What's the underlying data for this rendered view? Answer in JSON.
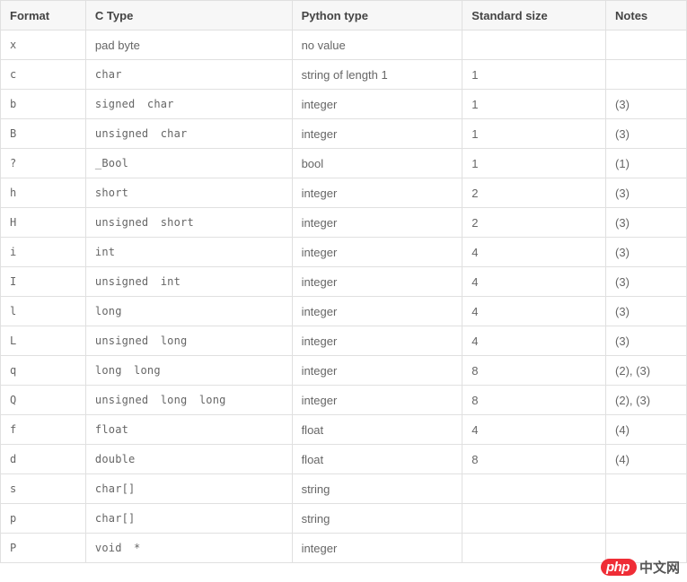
{
  "table": {
    "headers": [
      "Format",
      "C Type",
      "Python type",
      "Standard size",
      "Notes"
    ],
    "rows": [
      {
        "format": "x",
        "ctype": "pad byte",
        "ctype_mono": false,
        "python": "no value",
        "size": "",
        "notes": ""
      },
      {
        "format": "c",
        "ctype": "char",
        "ctype_mono": true,
        "python": "string of length 1",
        "size": "1",
        "notes": ""
      },
      {
        "format": "b",
        "ctype": "signed char",
        "ctype_mono": true,
        "python": "integer",
        "size": "1",
        "notes": "(3)"
      },
      {
        "format": "B",
        "ctype": "unsigned char",
        "ctype_mono": true,
        "python": "integer",
        "size": "1",
        "notes": "(3)"
      },
      {
        "format": "?",
        "ctype": "_Bool",
        "ctype_mono": true,
        "python": "bool",
        "size": "1",
        "notes": "(1)"
      },
      {
        "format": "h",
        "ctype": "short",
        "ctype_mono": true,
        "python": "integer",
        "size": "2",
        "notes": "(3)"
      },
      {
        "format": "H",
        "ctype": "unsigned short",
        "ctype_mono": true,
        "python": "integer",
        "size": "2",
        "notes": "(3)"
      },
      {
        "format": "i",
        "ctype": "int",
        "ctype_mono": true,
        "python": "integer",
        "size": "4",
        "notes": "(3)"
      },
      {
        "format": "I",
        "ctype": "unsigned int",
        "ctype_mono": true,
        "python": "integer",
        "size": "4",
        "notes": "(3)"
      },
      {
        "format": "l",
        "ctype": "long",
        "ctype_mono": true,
        "python": "integer",
        "size": "4",
        "notes": "(3)"
      },
      {
        "format": "L",
        "ctype": "unsigned long",
        "ctype_mono": true,
        "python": "integer",
        "size": "4",
        "notes": "(3)"
      },
      {
        "format": "q",
        "ctype": "long long",
        "ctype_mono": true,
        "python": "integer",
        "size": "8",
        "notes": "(2), (3)"
      },
      {
        "format": "Q",
        "ctype": "unsigned long long",
        "ctype_mono": true,
        "python": "integer",
        "size": "8",
        "notes": "(2), (3)"
      },
      {
        "format": "f",
        "ctype": "float",
        "ctype_mono": true,
        "python": "float",
        "size": "4",
        "notes": "(4)"
      },
      {
        "format": "d",
        "ctype": "double",
        "ctype_mono": true,
        "python": "float",
        "size": "8",
        "notes": "(4)"
      },
      {
        "format": "s",
        "ctype": "char[]",
        "ctype_mono": true,
        "python": "string",
        "size": "",
        "notes": ""
      },
      {
        "format": "p",
        "ctype": "char[]",
        "ctype_mono": true,
        "python": "string",
        "size": "",
        "notes": ""
      },
      {
        "format": "P",
        "ctype": "void *",
        "ctype_mono": true,
        "python": "integer",
        "size": "",
        "notes": ""
      }
    ]
  },
  "watermark": {
    "badge": "php",
    "text": "中文网"
  }
}
